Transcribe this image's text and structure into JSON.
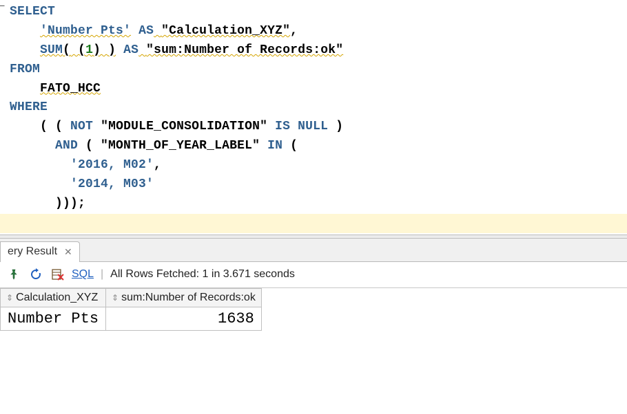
{
  "sql": {
    "kw_select": "SELECT",
    "lit_numberpts": "'Number Pts'",
    "kw_as1": "AS",
    "dq_calcxyz": "\"Calculation_XYZ\"",
    "comma1": ",",
    "fn_sum": "SUM",
    "open1": "(",
    "sp_open": " (",
    "num_one": "1",
    "close_in": ") ",
    "close1": ")",
    "kw_as2": "AS",
    "dq_sumrec": "\"sum:Number of Records:ok\"",
    "kw_from": "FROM",
    "id_table": "FATO_HCC",
    "kw_where": "WHERE",
    "p_o1": "( ( ",
    "kw_not": "NOT",
    "dq_modcon": "\"MODULE_CONSOLIDATION\"",
    "kw_is": "IS",
    "kw_null": "NULL",
    "p_c1": " )",
    "kw_and": "AND",
    "p_o2": " ( ",
    "dq_month": "\"MONTH_OF_YEAR_LABEL\"",
    "kw_in": "IN",
    "p_o3": " (",
    "lit_2016": "'2016, M02'",
    "comma2": ",",
    "lit_2014": "'2014, M03'",
    "p_close_all": ")));"
  },
  "tab": {
    "label": "ery Result",
    "close": "✕"
  },
  "toolbar": {
    "sql_label": "SQL",
    "status": "All Rows Fetched: 1 in 3.671 seconds"
  },
  "result": {
    "headers": {
      "c1": "Calculation_XYZ",
      "c2": "sum:Number of Records:ok"
    },
    "row": {
      "c1": "Number Pts",
      "c2": "1638"
    }
  }
}
